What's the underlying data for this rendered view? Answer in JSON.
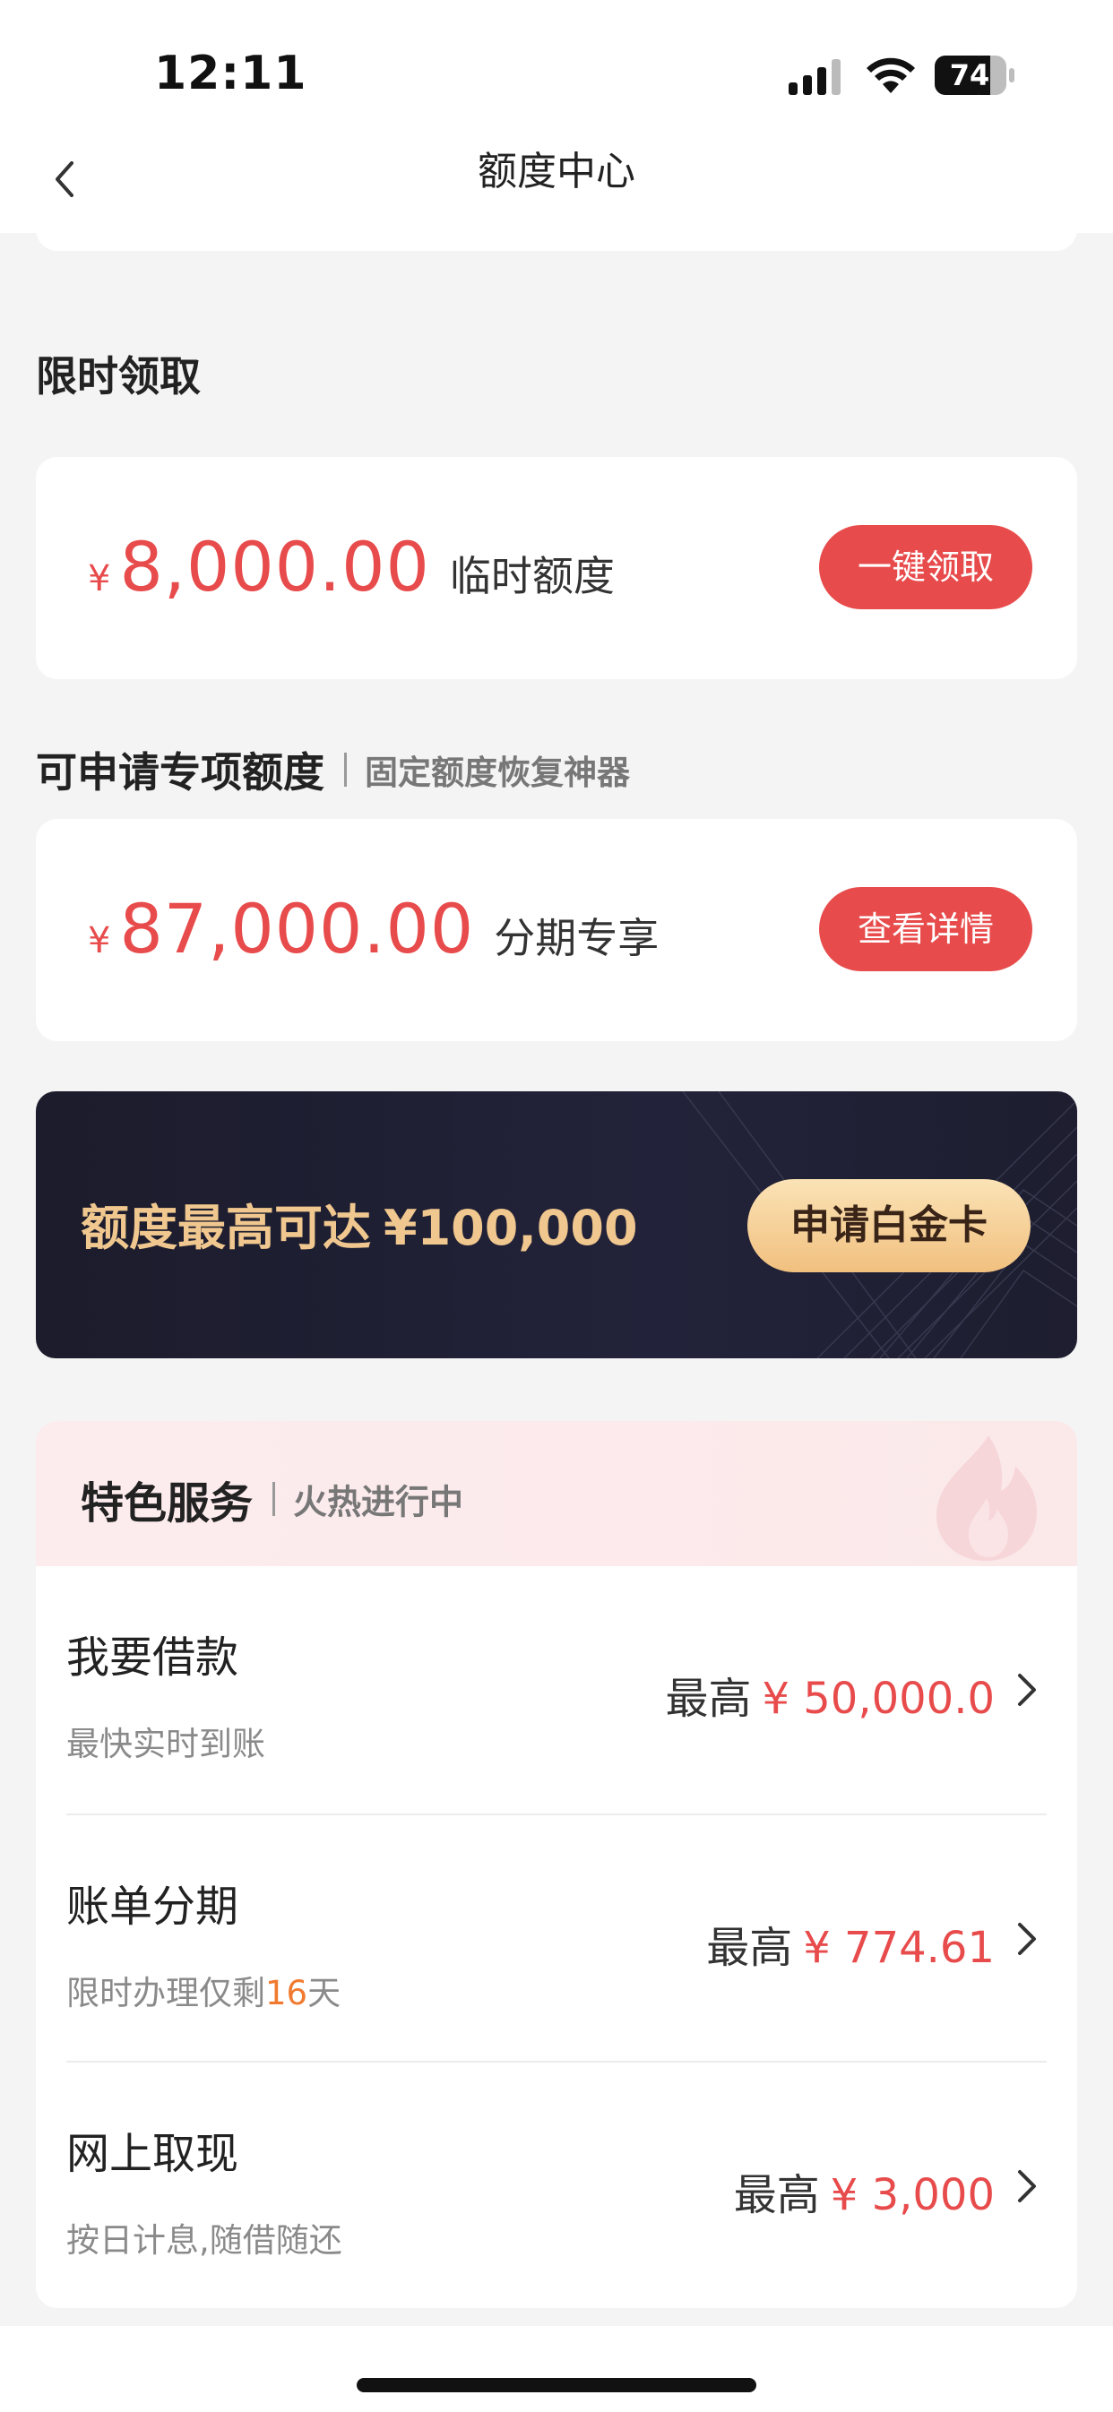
{
  "status_bar": {
    "time": "12:11",
    "battery": "74"
  },
  "nav": {
    "title": "额度中心"
  },
  "section_limited": {
    "title": "限时领取"
  },
  "temp_quota": {
    "currency": "¥",
    "amount": "8,000.00",
    "label": "临时额度",
    "button": "一键领取"
  },
  "section_special": {
    "title": "可申请专项额度",
    "subtitle": "固定额度恢复神器"
  },
  "special_quota": {
    "currency": "¥",
    "amount": "87,000.00",
    "label": "分期专享",
    "button": "查看详情"
  },
  "platinum_banner": {
    "text": "额度最高可达",
    "currency": "¥",
    "amount": "100,000",
    "button": "申请白金卡"
  },
  "services": {
    "title": "特色服务",
    "subtitle": "火热进行中",
    "items": [
      {
        "name": "我要借款",
        "desc": "最快实时到账",
        "prefix": "最高",
        "amount": "¥ 50,000.0"
      },
      {
        "name": "账单分期",
        "desc_before": "限时办理仅剩",
        "desc_highlight": "16",
        "desc_after": "天",
        "prefix": "最高",
        "amount": "¥ 774.61"
      },
      {
        "name": "网上取现",
        "desc": "按日计息,随借随还",
        "prefix": "最高",
        "amount": "¥ 3,000"
      }
    ]
  },
  "colors": {
    "accent_red": "#e84b4b",
    "gold": "#f0c78e",
    "banner_dark": "#1c1c2c",
    "highlight_orange": "#f07a2f"
  },
  "icons": [
    "signal-icon",
    "wifi-icon",
    "battery-icon",
    "back-icon",
    "flame-icon",
    "chevron-right-icon"
  ]
}
